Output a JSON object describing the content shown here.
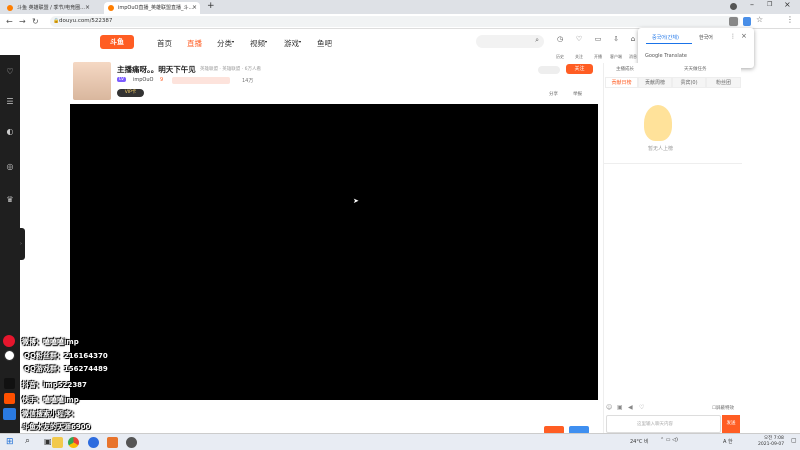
{
  "browser": {
    "tabs": [
      {
        "label": "斗鱼 英雄联盟 / 季节/电竞圈...",
        "active": false
      },
      {
        "label": "impOuO直播_英雄联盟直播_斗...",
        "active": true
      }
    ],
    "url": "douyu.com/522387"
  },
  "site": {
    "logo": "斗鱼",
    "nav": [
      "首页",
      "直播",
      "分类",
      "视频",
      "游戏",
      "鱼吧"
    ],
    "header_icons": [
      "历史",
      "关注",
      "开播",
      "客户端",
      "消息"
    ]
  },
  "streamer": {
    "title": "主播痛呀。。明天下午见",
    "category_link": "英雄联盟 · 英雄联盟 · 6万人看",
    "name": "impOuO",
    "level_badge": "LV",
    "hot": "9",
    "fans": "14万",
    "rank": "VIP",
    "follow_label": "关注",
    "share_label": "分享",
    "report_label": "举报",
    "badge_text": "VIP卡"
  },
  "side_panel": {
    "tabs": [
      "贡献日榜",
      "贡献周榜",
      "贵宾(0)",
      "粉丝团"
    ],
    "empty_text": "暂无人上榜",
    "chat_placeholder": "这里输入聊天内容",
    "send_label": "发送",
    "shield_label": "屏蔽特效",
    "top_labels": [
      "主播成长",
      "天天做任务"
    ]
  },
  "overlay": {
    "lines": [
      "微博：嗑嗑嗑imp",
      "QQ粉丝群：216164370",
      "QQ游戏群：156274489",
      "抖音：imp522387",
      "快手：嗑嗑嗑imp",
      "微信搜索小程序：",
      "斗鱼水友的天涯6900"
    ]
  },
  "translate_popup": {
    "lang1": "중국어(간체)",
    "lang2": "한국어",
    "footer": "Google Translate"
  },
  "taskbar": {
    "weather": "24°C 비",
    "ime": "A 한",
    "time": "오전 7:08",
    "date": "2021-09-07"
  }
}
